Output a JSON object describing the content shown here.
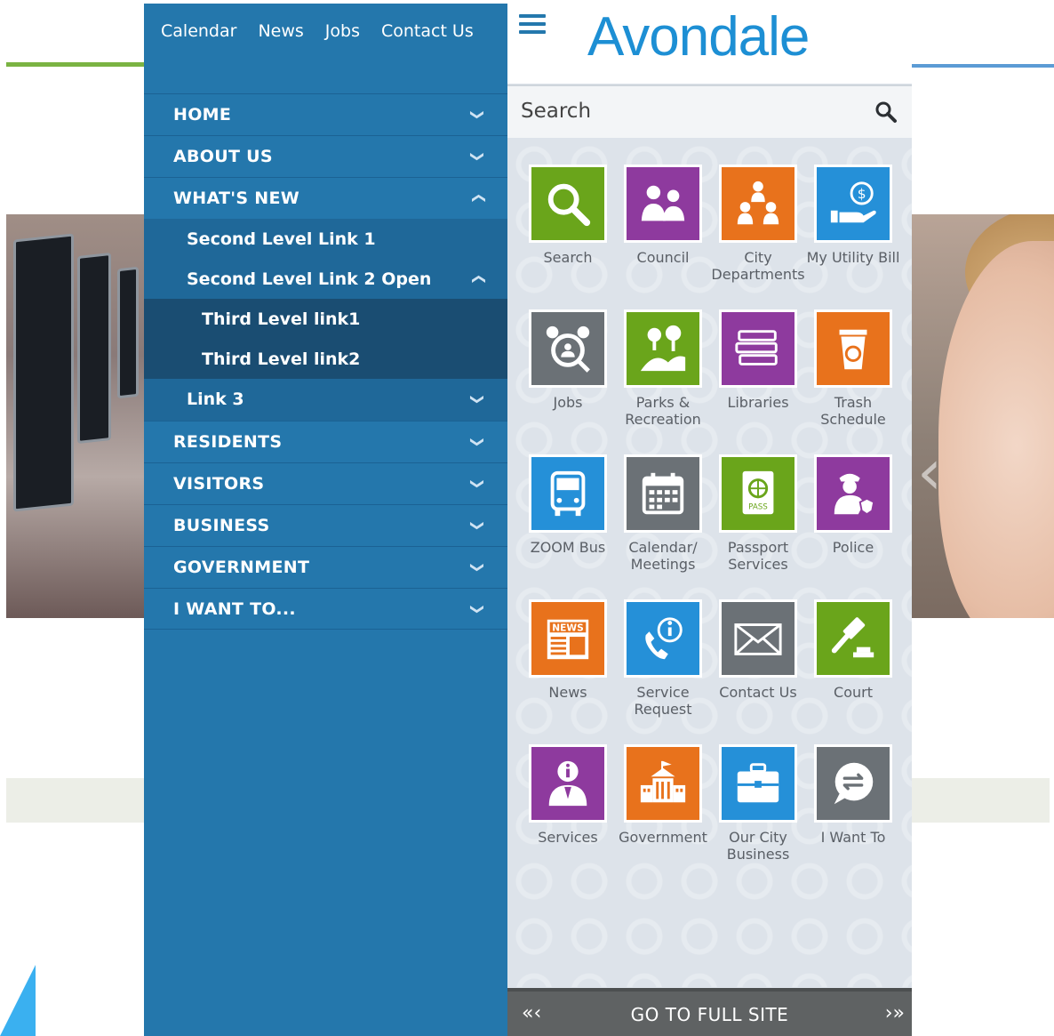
{
  "menu": {
    "top_links": [
      "Calendar",
      "News",
      "Jobs",
      "Contact Us"
    ],
    "items": {
      "home": "HOME",
      "about": "ABOUT US",
      "whats_new": "WHAT'S NEW",
      "second_link_1": "Second Level Link 1",
      "second_link_2": "Second Level Link 2 Open",
      "third_link_1": "Third Level link1",
      "third_link_2": "Third Level link2",
      "link_3": "Link 3",
      "residents": "RESIDENTS",
      "visitors": "VISITORS",
      "business": "BUSINESS",
      "government": "GOVERNMENT",
      "i_want_to": "I WANT TO..."
    }
  },
  "header": {
    "logo": "Avondale"
  },
  "search": {
    "placeholder": "Search"
  },
  "tiles": [
    {
      "label": "Search",
      "color": "#6aa51b",
      "icon": "search-icon"
    },
    {
      "label": "Council",
      "color": "#8e3a9e",
      "icon": "council-people-icon"
    },
    {
      "label": "City Departments",
      "color": "#e8721c",
      "icon": "departments-people-icon"
    },
    {
      "label": "My Utility Bill",
      "color": "#2590d8",
      "icon": "utility-bill-hand-icon"
    },
    {
      "label": "Jobs",
      "color": "#6b7176",
      "icon": "jobs-alarm-icon"
    },
    {
      "label": "Parks & Recreation",
      "color": "#6aa51b",
      "icon": "parks-trees-icon"
    },
    {
      "label": "Libraries",
      "color": "#8e3a9e",
      "icon": "books-icon"
    },
    {
      "label": "Trash Schedule",
      "color": "#e8721c",
      "icon": "recycle-bin-icon"
    },
    {
      "label": "ZOOM Bus",
      "color": "#2590d8",
      "icon": "bus-icon"
    },
    {
      "label": "Calendar/ Meetings",
      "color": "#6b7176",
      "icon": "calendar-icon"
    },
    {
      "label": "Passport Services",
      "color": "#6aa51b",
      "icon": "passport-icon"
    },
    {
      "label": "Police",
      "color": "#8e3a9e",
      "icon": "police-officer-icon"
    },
    {
      "label": "News",
      "color": "#e8721c",
      "icon": "newspaper-icon"
    },
    {
      "label": "Service Request",
      "color": "#2590d8",
      "icon": "phone-info-icon"
    },
    {
      "label": "Contact Us",
      "color": "#6b7176",
      "icon": "envelope-icon"
    },
    {
      "label": "Court",
      "color": "#6aa51b",
      "icon": "gavel-icon"
    },
    {
      "label": "Services",
      "color": "#8e3a9e",
      "icon": "info-person-icon"
    },
    {
      "label": "Government",
      "color": "#e8721c",
      "icon": "government-building-icon"
    },
    {
      "label": "Our City Business",
      "color": "#2590d8",
      "icon": "briefcase-icon"
    },
    {
      "label": "I Want To",
      "color": "#6b7176",
      "icon": "exchange-bubble-icon"
    }
  ],
  "tile_badges": {
    "news": "NEWS",
    "pass": "PASS"
  },
  "footer": {
    "label": "GO TO FULL SITE",
    "left_arrows": "«‹",
    "right_arrows": "›»"
  }
}
